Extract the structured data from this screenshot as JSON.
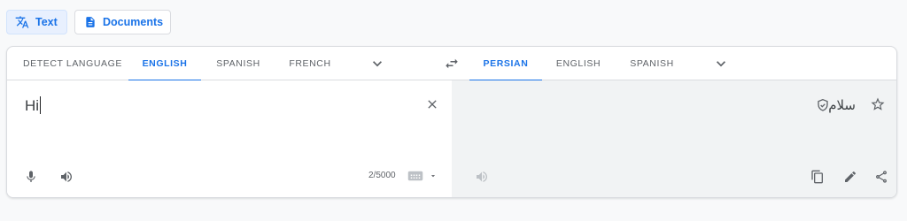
{
  "modes": {
    "text_label": "Text",
    "documents_label": "Documents"
  },
  "source_languages": [
    "DETECT LANGUAGE",
    "ENGLISH",
    "SPANISH",
    "FRENCH"
  ],
  "source_active": "ENGLISH",
  "target_languages": [
    "PERSIAN",
    "ENGLISH",
    "SPANISH"
  ],
  "target_active": "PERSIAN",
  "source": {
    "text": "Hi",
    "char_count": "2/5000"
  },
  "target": {
    "text": "سلام"
  },
  "colors": {
    "accent": "#1a73e8",
    "text": "#3c4043",
    "muted": "#5f6368",
    "panel_bg": "#f1f3f4"
  },
  "icons": {
    "text_mode": "translate-icon",
    "documents_mode": "document-icon",
    "more_languages": "chevron-down-icon",
    "swap": "swap-icon",
    "clear": "close-icon",
    "mic": "mic-icon",
    "listen": "speaker-icon",
    "keyboard": "keyboard-icon",
    "verified": "shield-check-icon",
    "save": "star-icon",
    "copy": "copy-icon",
    "edit": "pencil-icon",
    "share": "share-icon"
  }
}
